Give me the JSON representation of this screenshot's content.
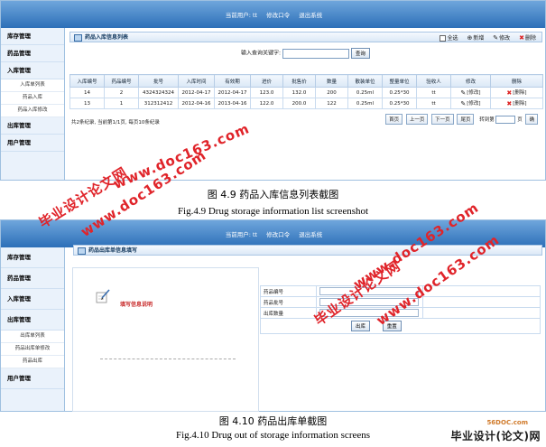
{
  "screen1": {
    "top": {
      "current_user_label": "当前用户: tt",
      "change_pwd": "修改口令",
      "logout": "退出系统"
    },
    "sidebar": {
      "item1": "库存管理",
      "item2": "药品管理",
      "item3": "入库管理",
      "sub1": "入库单列表",
      "sub2": "药品入库",
      "sub3": "药品入库修改",
      "item4": "出库管理",
      "item5": "用户管理"
    },
    "panel_title": "药品入库信息列表",
    "toolbar": {
      "select_all": "全选",
      "add": "新增",
      "edit": "修改",
      "delete": "删除"
    },
    "search": {
      "label": "输入查询关键字:",
      "button": "查询"
    },
    "columns": [
      "入库编号",
      "药品编号",
      "批号",
      "入库时间",
      "有效期",
      "进价",
      "批售价",
      "数量",
      "散装单位",
      "整量单位",
      "验收人",
      "修改",
      "删除"
    ],
    "rows": [
      [
        "14",
        "2",
        "4324324324",
        "2012-04-17",
        "2012-04-17",
        "123.0",
        "132.0",
        "200",
        "0.25ml",
        "0.25*30",
        "tt",
        "[修改]",
        "[删除]"
      ],
      [
        "13",
        "1",
        "312312412",
        "2012-04-16",
        "2013-04-16",
        "122.0",
        "200.0",
        "122",
        "0.25ml",
        "0.25*30",
        "tt",
        "[修改]",
        "[删除]"
      ]
    ],
    "pager": {
      "summary": "共2条纪录, 当前第1/1页, 每页10条纪录",
      "first": "首页",
      "prev": "上一页",
      "next": "下一页",
      "last": "尾页",
      "goto": "转到第",
      "unit": "页",
      "go": "确"
    }
  },
  "caption1": {
    "zh": "图 4.9  药品入库信息列表截图",
    "en": "Fig.4.9    Drug storage information list screenshot"
  },
  "screen2": {
    "top": {
      "current_user_label": "当前用户: tt",
      "change_pwd": "修改口令",
      "logout": "退出系统"
    },
    "sidebar": {
      "item1": "库存管理",
      "item2": "药品管理",
      "item3": "入库管理",
      "item4": "出库管理",
      "sub1": "出库单列表",
      "sub2": "药品出库单修改",
      "sub3": "药品出库",
      "item5": "用户管理"
    },
    "panel_title": "药品出库单信息填写",
    "note_label": "填写信息说明",
    "form": {
      "f1": "药品编号",
      "f2": "药品批号",
      "f3": "出库数量"
    },
    "buttons": {
      "submit": "出库",
      "reset": "重置"
    }
  },
  "caption2": {
    "zh": "图 4.10  药品出库单截图",
    "en": "Fig.4.10    Drug out of storage information screens"
  },
  "watermarks": {
    "site": "www.doc163.com",
    "brand": "毕业设计论文网"
  },
  "brand": {
    "site": "56DOC.com",
    "name": "毕业设计(论文)网"
  },
  "colors": {
    "header_blue": "#2c6fb8",
    "watermark_red": "#e0242a",
    "grid_border": "#c9dbef",
    "delete_red": "#d22"
  }
}
